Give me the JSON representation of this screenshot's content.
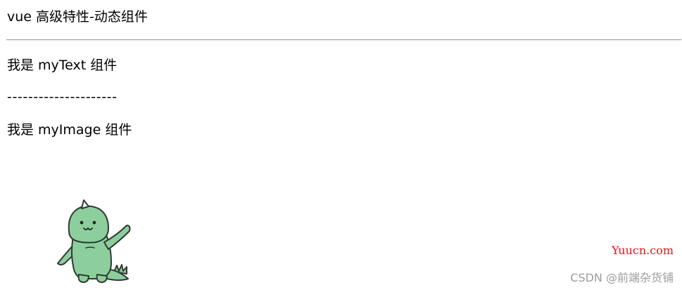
{
  "page": {
    "title": "vue 高级特性-动态组件",
    "text_component": "我是 myText 组件",
    "separator": "---------------------",
    "image_component": "我是 myImage 组件"
  },
  "image": {
    "icon": "dinosaur-icon",
    "colors": {
      "body": "#8ccf9d",
      "outline": "#2f3a33",
      "mouth": "#1f2a24"
    }
  },
  "watermarks": {
    "yuucn": "Yuucn.com",
    "csdn": "CSDN @前端杂货铺",
    "yuucn_color": "#e8141e",
    "csdn_color": "#9c9c9c"
  }
}
